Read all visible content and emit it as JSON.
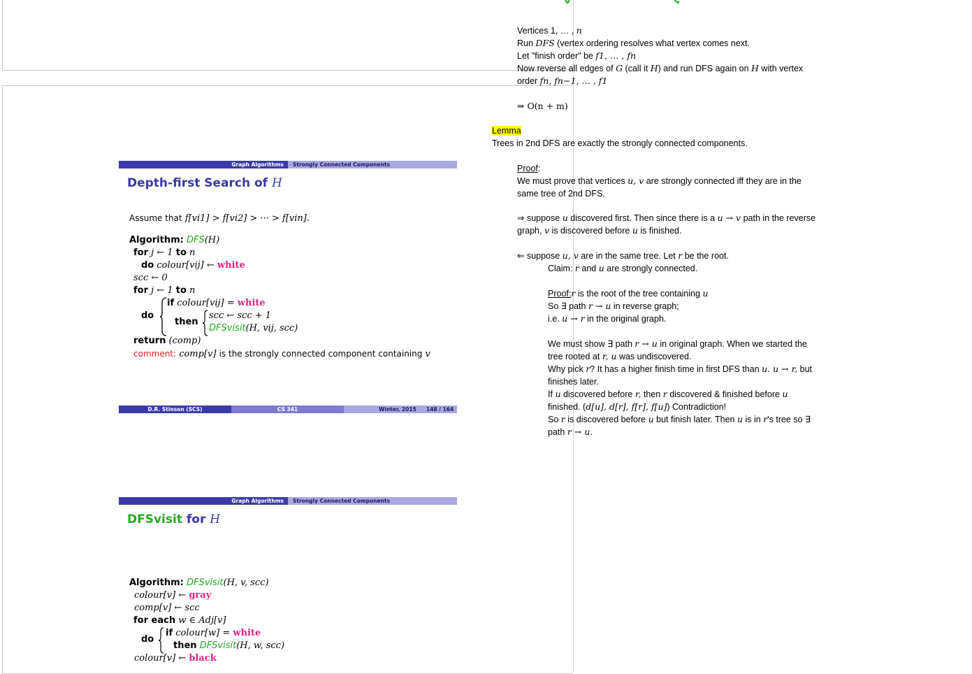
{
  "header_slide": {
    "section": "Graph Algorithms",
    "subsection": "Strongly Connected Components"
  },
  "slide1": {
    "title_word": "Depth-first Search of",
    "title_math": "H",
    "assume_text": "Assume that",
    "assume_math": "f[vi1] > f[vi2] > ··· > f[vin].",
    "alg_label": "Algorithm:",
    "alg_name": "DFS",
    "alg_args": "(H)",
    "line_for1_kw": "for",
    "line_for1_math": "j ← 1",
    "line_to_kw": "to",
    "line_for1_n": "n",
    "line_do_kw": "do",
    "line_colour_math": "colour[vij] ←",
    "white": "white",
    "line_scc_math": "scc ← 0",
    "line_for2_math": "j ← 1",
    "line_if_kw": "if",
    "line_if_math": "colour[vij] =",
    "then_kw": "then",
    "line_scc_inc": "scc ← scc + 1",
    "dfsvisit_name": "DFSvisit",
    "dfsvisit_args": "(H, vij, scc)",
    "return_kw": "return",
    "return_math": "(comp)",
    "comment_kw": "comment:",
    "comment_math": "comp[v]",
    "comment_text": "is the strongly connected component containing",
    "comment_v": "v"
  },
  "footer": {
    "author": "D.R. Stinson (SCS)",
    "course": "CS 341",
    "term": "Winter, 2015",
    "page": "148 / 164"
  },
  "slide2": {
    "title_word": "DFSvisit",
    "title_for": "for",
    "title_math": "H",
    "alg_label": "Algorithm:",
    "alg_name": "DFSvisit",
    "alg_args": "(H, v, scc)",
    "line1_math": "colour[v] ←",
    "gray": "gray",
    "line2_math": "comp[v] ← scc",
    "foreach_kw": "for each",
    "foreach_math": "w ∈ Adj[v]",
    "do_kw": "do",
    "if_kw": "if",
    "if_math": "colour[w] =",
    "white": "white",
    "then_kw": "then",
    "call_name": "DFSvisit",
    "call_args": "(H, w, scc)",
    "last_math": "colour[v] ←",
    "black": "black"
  },
  "notes": {
    "l1a": "Vertices 1, … ,",
    "l1m": "n",
    "l2a": "Run",
    "l2m": "DFS",
    "l2b": "(vertex ordering resolves what vertex comes next.",
    "l3a": "Let \"finish order\" be",
    "l3m": "f1, … , fn",
    "l4a": "Now reverse all edges of",
    "l4m1": "G",
    "l4b": "(call it",
    "l4m2": "H",
    "l4c": ") and run DFS again on",
    "l4m3": "H",
    "l4d": "with vertex",
    "l5a": "order",
    "l5m": "fn, fn−1, … , f1",
    "l6": "⇒ O(n + m)",
    "lemma": "Lemma",
    "lemma_text": "Trees in 2nd DFS are exactly the strongly connected components.",
    "proof": "Proof",
    "proof_colon": ":",
    "p1a": "We must prove that vertices",
    "p1m": "u, v",
    "p1b": "are strongly connected iff they are in the",
    "p2": "same tree of 2nd DFS.",
    "f1a": "⇒ suppose",
    "f1m1": "u",
    "f1b": "discovered first. Then since there is a",
    "f1m2": "u → v",
    "f1c": "path in the reverse",
    "f2a": "graph,",
    "f2m1": "v",
    "f2b": "is discovered before",
    "f2m2": "u",
    "f2c": "is finished.",
    "b1a": "⇐ suppose",
    "b1m1": "u, v",
    "b1b": "are in the same tree. Let",
    "b1m2": "r",
    "b1c": "be the root.",
    "c1a": "Claim:",
    "c1m1": "r",
    "c1b": "and",
    "c1m2": "u",
    "c1c": "are strongly connected.",
    "pr_label": "Proof:",
    "pr1m": "r",
    "pr1a": "is the root of the tree containing",
    "pr1m2": "u",
    "pr2a": "So ∃ path",
    "pr2m": "r → u",
    "pr2b": "in reverse graph;",
    "pr3a": "i.e.",
    "pr3m": "u → r",
    "pr3b": "in the original graph.",
    "w1a": "We must show ∃ path",
    "w1m": "r → u",
    "w1b": "in original graph. When we started the",
    "w2a": "tree rooted at",
    "w2m": "r, u",
    "w2b": "was undiscovered.",
    "w3a": "Why pick",
    "w3m": "r",
    "w3b": "? It has a higher finish time in first DFS than",
    "w3m2": "u. u → r,",
    "w3c": "but",
    "w4": "finishes later.",
    "w5a": "If",
    "w5m": "u",
    "w5b": "discovered before",
    "w5m2": "r,",
    "w5c": "then",
    "w5m3": "r",
    "w5d": "discovered & finished before",
    "w5m4": "u",
    "w6a": "finished. (",
    "w6m": "d[u], d[r], f[r], f[u]",
    "w6b": ") Contradiction!",
    "w7a": "So",
    "w7m": "r",
    "w7b": "is discovered before",
    "w7m2": "u",
    "w7c": "but finish later. Then",
    "w7m3": "u",
    "w7d": "is in",
    "w7m4": "r",
    "w7e": "'s tree so ∃",
    "w8a": "path",
    "w8m": "r → u."
  },
  "colors": {
    "header_dark": "#3a3aa8",
    "header_light": "#a8a8e0",
    "green": "#22aa22",
    "magenta": "#e0208a",
    "highlight": "#ffff00"
  }
}
